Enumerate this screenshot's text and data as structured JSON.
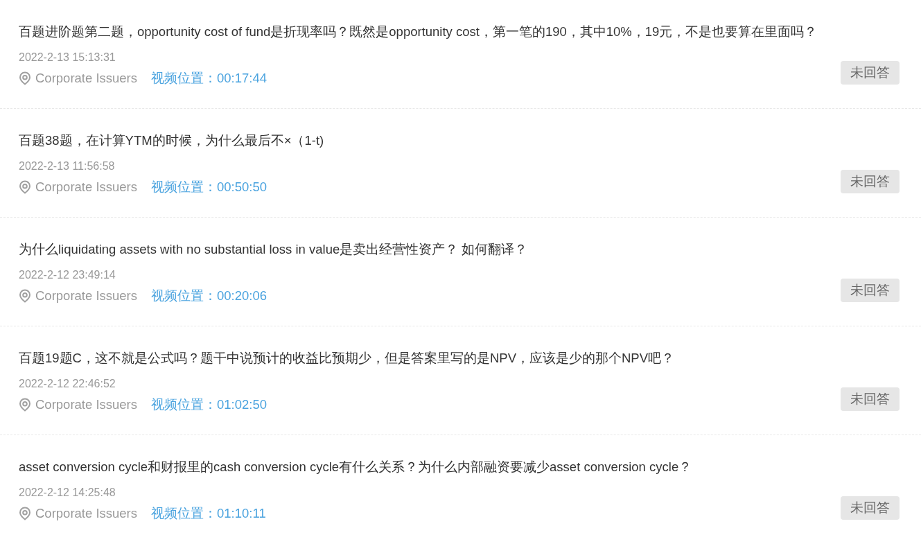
{
  "questions": [
    {
      "text": "百题进阶题第二题，opportunity cost of fund是折现率吗？既然是opportunity cost，第一笔的190，其中10%，19元，不是也要算在里面吗？",
      "date": "2022-2-13 15:13:31",
      "subject": "Corporate Issuers",
      "video_label": "视频位置：",
      "video_time": "00:17:44",
      "status": "未回答"
    },
    {
      "text": "百题38题，在计算YTM的时候，为什么最后不×（1-t)",
      "date": "2022-2-13 11:56:58",
      "subject": "Corporate Issuers",
      "video_label": "视频位置：",
      "video_time": "00:50:50",
      "status": "未回答"
    },
    {
      "text": "为什么liquidating assets with no substantial loss in value是卖出经营性资产？ 如何翻译？",
      "date": "2022-2-12 23:49:14",
      "subject": "Corporate Issuers",
      "video_label": "视频位置：",
      "video_time": "00:20:06",
      "status": "未回答"
    },
    {
      "text": "百题19题C，这不就是公式吗？题干中说预计的收益比预期少，但是答案里写的是NPV，应该是少的那个NPV吧？",
      "date": "2022-2-12 22:46:52",
      "subject": "Corporate Issuers",
      "video_label": "视频位置：",
      "video_time": "01:02:50",
      "status": "未回答"
    },
    {
      "text": "asset conversion cycle和财报里的cash conversion cycle有什么关系？为什么内部融资要减少asset conversion cycle？",
      "date": "2022-2-12 14:25:48",
      "subject": "Corporate Issuers",
      "video_label": "视频位置：",
      "video_time": "01:10:11",
      "status": "未回答"
    }
  ]
}
